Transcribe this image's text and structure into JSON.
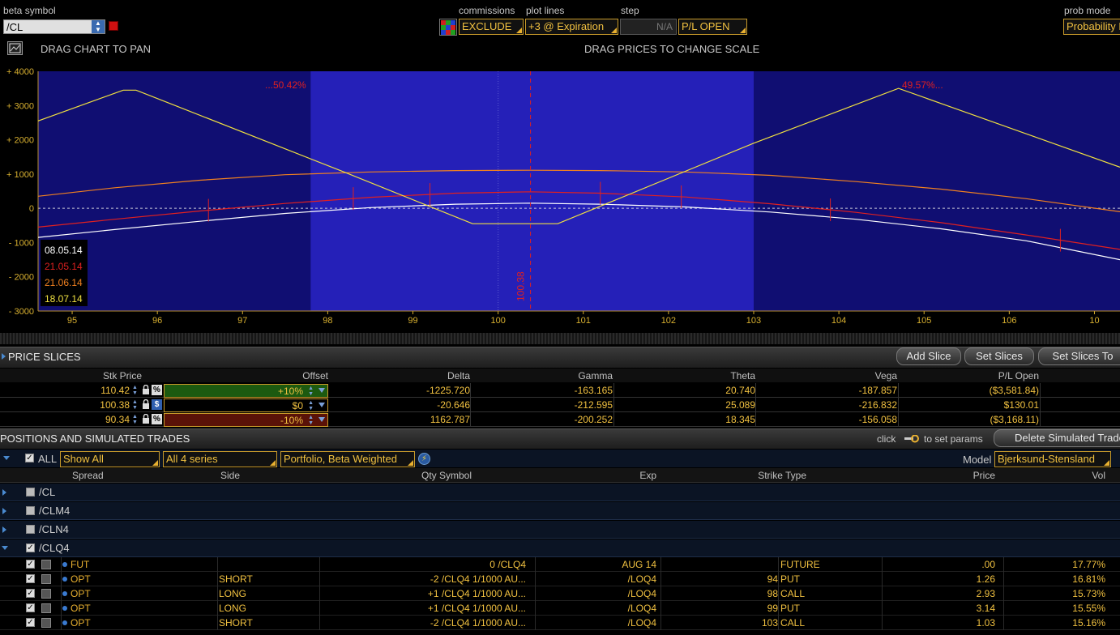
{
  "toolbar": {
    "beta_symbol_label": "beta symbol",
    "beta_symbol_value": "/CL",
    "commissions_label": "commissions",
    "commissions_value": "EXCLUDE",
    "plot_lines_label": "plot lines",
    "plot_lines_value": "+3 @ Expiration",
    "step_label": "step",
    "step_value": "N/A",
    "pl_mode_value": "P/L OPEN",
    "prob_mode_label": "prob mode",
    "prob_mode_value": "Probability I"
  },
  "chart_header": {
    "pan_hint": "DRAG CHART TO PAN",
    "scale_hint": "DRAG PRICES TO CHANGE SCALE"
  },
  "chart_data": {
    "type": "line",
    "xlim": [
      94.6,
      107.3
    ],
    "ylim": [
      -3000,
      4000
    ],
    "x_ticks": [
      "95",
      "96",
      "97",
      "98",
      "99",
      "100",
      "101",
      "102",
      "103",
      "104",
      "105",
      "106",
      "10"
    ],
    "y_ticks": [
      "+ 4000",
      "+ 3000",
      "+ 2000",
      "+ 1000",
      "0",
      "- 1000",
      "- 2000",
      "- 3000"
    ],
    "current_price_label": "100.38",
    "current_price": 100.38,
    "probability_left_label": "...50.42%",
    "probability_right_label": "49.57%...",
    "shaded_band": [
      97.8,
      103.0
    ],
    "series": [
      {
        "name": "08.05.14",
        "color": "#ffffff",
        "points": [
          [
            94.6,
            -850
          ],
          [
            95.5,
            -620
          ],
          [
            96.5,
            -380
          ],
          [
            97.5,
            -150
          ],
          [
            98.5,
            20
          ],
          [
            99.5,
            120
          ],
          [
            100.38,
            150
          ],
          [
            101.2,
            120
          ],
          [
            102.2,
            40
          ],
          [
            103.2,
            -110
          ],
          [
            104.2,
            -320
          ],
          [
            105.2,
            -600
          ],
          [
            106.2,
            -950
          ],
          [
            107.3,
            -1500
          ]
        ]
      },
      {
        "name": "21.05.14",
        "color": "#e02020",
        "points": [
          [
            94.6,
            -550
          ],
          [
            95.5,
            -320
          ],
          [
            96.5,
            -80
          ],
          [
            97.5,
            140
          ],
          [
            98.5,
            320
          ],
          [
            99.5,
            440
          ],
          [
            100.38,
            480
          ],
          [
            101.2,
            440
          ],
          [
            102.2,
            330
          ],
          [
            103.2,
            130
          ],
          [
            104.2,
            -120
          ],
          [
            105.2,
            -420
          ],
          [
            106.2,
            -780
          ],
          [
            107.3,
            -1200
          ]
        ]
      },
      {
        "name": "21.06.14",
        "color": "#f08020",
        "points": [
          [
            94.6,
            350
          ],
          [
            95.5,
            600
          ],
          [
            96.5,
            820
          ],
          [
            97.5,
            980
          ],
          [
            98.5,
            1060
          ],
          [
            99.5,
            1100
          ],
          [
            100.38,
            1110
          ],
          [
            101.2,
            1100
          ],
          [
            102.2,
            1060
          ],
          [
            103.2,
            960
          ],
          [
            104.2,
            780
          ],
          [
            105.2,
            560
          ],
          [
            106.2,
            280
          ],
          [
            107.3,
            -100
          ]
        ]
      },
      {
        "name": "18.07.14",
        "color": "#f0e040",
        "points": [
          [
            94.6,
            2550
          ],
          [
            95.6,
            3450
          ],
          [
            95.75,
            3450
          ],
          [
            98.2,
            1050
          ],
          [
            99.7,
            -450
          ],
          [
            100.7,
            -450
          ],
          [
            103.0,
            1900
          ],
          [
            104.7,
            3500
          ],
          [
            107.3,
            1200
          ]
        ]
      }
    ]
  },
  "price_slices": {
    "title": "PRICE SLICES",
    "add_slice": "Add Slice",
    "set_slices": "Set Slices",
    "set_slices_to": "Set Slices To",
    "columns": [
      "Stk Price",
      "Offset",
      "Delta",
      "Gamma",
      "Theta",
      "Vega",
      "P/L Open"
    ],
    "rows": [
      {
        "stk": "110.42",
        "unit": "%",
        "offset": "+10%",
        "delta": "-1225.720",
        "gamma": "-163.165",
        "theta": "20.740",
        "vega": "-187.857",
        "pl": "($3,581.84)"
      },
      {
        "stk": "100.38",
        "unit": "$",
        "offset": "$0",
        "delta": "-20.646",
        "gamma": "-212.595",
        "theta": "25.089",
        "vega": "-216.832",
        "pl": "$130.01"
      },
      {
        "stk": "90.34",
        "unit": "%",
        "offset": "-10%",
        "delta": "1162.787",
        "gamma": "-200.252",
        "theta": "18.345",
        "vega": "-156.058",
        "pl": "($3,168.11)"
      }
    ]
  },
  "positions": {
    "title": "POSITIONS AND SIMULATED TRADES",
    "click_hint": "click",
    "params_hint": "to set params",
    "delete_btn": "Delete Simulated Trades",
    "all_label": "ALL",
    "filter_show": "Show All",
    "filter_series": "All 4 series",
    "filter_portfolio": "Portfolio, Beta Weighted",
    "model_label": "Model",
    "model_value": "Bjerksund-Stensland",
    "columns": {
      "spread": "Spread",
      "side": "Side",
      "qty_symbol": "Qty Symbol",
      "exp": "Exp",
      "strike_type": "Strike Type",
      "price": "Price",
      "vol": "Vol"
    },
    "groups": [
      {
        "name": "/CL"
      },
      {
        "name": "/CLM4"
      },
      {
        "name": "/CLN4"
      },
      {
        "name": "/CLQ4"
      }
    ],
    "trades": [
      {
        "spread": "FUT",
        "side": "",
        "qty_symbol": "0 /CLQ4",
        "exp": "AUG 14",
        "strike": "",
        "type": "FUTURE",
        "price": ".00",
        "vol": "17.77%"
      },
      {
        "spread": "OPT",
        "side": "SHORT",
        "qty_symbol": "-2 /CLQ4 1/1000 AU...",
        "exp": "/LOQ4",
        "strike": "94",
        "type": "PUT",
        "price": "1.26",
        "vol": "16.81%"
      },
      {
        "spread": "OPT",
        "side": "LONG",
        "qty_symbol": "+1 /CLQ4 1/1000 AU...",
        "exp": "/LOQ4",
        "strike": "98",
        "type": "CALL",
        "price": "2.93",
        "vol": "15.73%"
      },
      {
        "spread": "OPT",
        "side": "LONG",
        "qty_symbol": "+1 /CLQ4 1/1000 AU...",
        "exp": "/LOQ4",
        "strike": "99",
        "type": "PUT",
        "price": "3.14",
        "vol": "15.55%"
      },
      {
        "spread": "OPT",
        "side": "SHORT",
        "qty_symbol": "-2 /CLQ4 1/1000 AU...",
        "exp": "/LOQ4",
        "strike": "103",
        "type": "CALL",
        "price": "1.03",
        "vol": "15.16%"
      }
    ]
  }
}
